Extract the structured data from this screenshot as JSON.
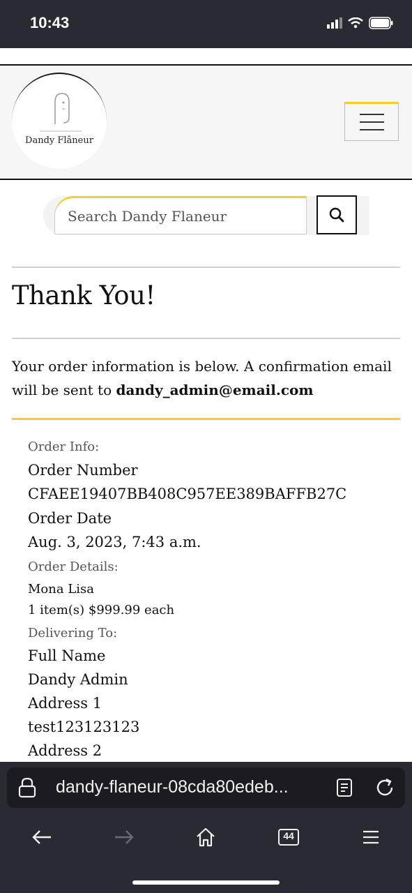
{
  "status_bar": {
    "time": "10:43"
  },
  "header": {
    "logo_text": "Dandy Flâneur"
  },
  "search": {
    "placeholder": "Search Dandy Flaneur"
  },
  "page": {
    "title": "Thank You!",
    "intro_text": "Your order information is below. A confirmation email will be sent to ",
    "email": "dandy_admin@email.com"
  },
  "order": {
    "info_label": "Order Info:",
    "number_label": "Order Number",
    "number_value": "CFAEE19407BB408C957EE389BAFFB27C",
    "date_label": "Order Date",
    "date_value": "Aug. 3, 2023, 7:43 a.m.",
    "details_label": "Order Details:",
    "item_name": "Mona Lisa",
    "item_qty_price": "1 item(s) $999.99 each",
    "delivering_label": "Delivering To:",
    "full_name_label": "Full Name",
    "full_name_value": "Dandy Admin",
    "address1_label": "Address 1",
    "address1_value": "test123123123",
    "address2_label": "Address 2"
  },
  "browser": {
    "url": "dandy-flaneur-08cda80edeb...",
    "tab_count": "44"
  },
  "colors": {
    "accent": "#f2cf2b",
    "dark_bar": "#2a2a33"
  }
}
